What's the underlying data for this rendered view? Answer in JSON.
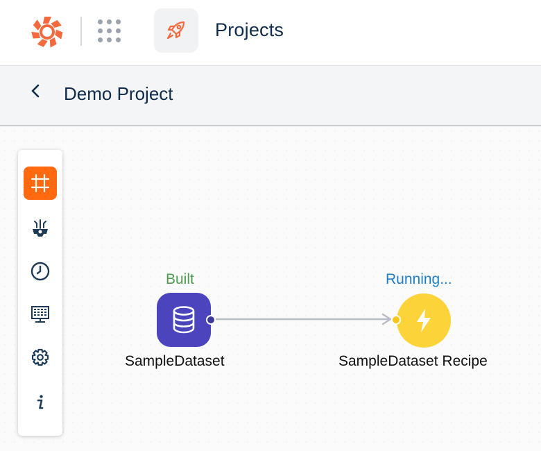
{
  "header": {
    "title": "Projects",
    "logo_icon": "spinner-logo-icon",
    "apps_icon": "apps-grid-icon",
    "module_icon": "rocket-icon",
    "accent": "#ff6a10"
  },
  "subheader": {
    "title": "Demo Project",
    "back_icon": "chevron-left-icon"
  },
  "toolbar": {
    "items": [
      {
        "name": "canvas-icon",
        "active": true
      },
      {
        "name": "gear-plugin-icon",
        "active": false
      },
      {
        "name": "clock-icon",
        "active": false
      },
      {
        "name": "dashboard-icon",
        "active": false
      },
      {
        "name": "settings-icon",
        "active": false
      },
      {
        "name": "info-icon",
        "active": false
      }
    ]
  },
  "flow": {
    "nodes": [
      {
        "label": "SampleDataset",
        "status": "Built",
        "status_color": "#4e9a4e",
        "type": "dataset",
        "color": "#4b44bd"
      },
      {
        "label": "SampleDataset Recipe",
        "status": "Running...",
        "status_color": "#1c7fc9",
        "type": "recipe",
        "color": "#fcd43a"
      }
    ]
  }
}
